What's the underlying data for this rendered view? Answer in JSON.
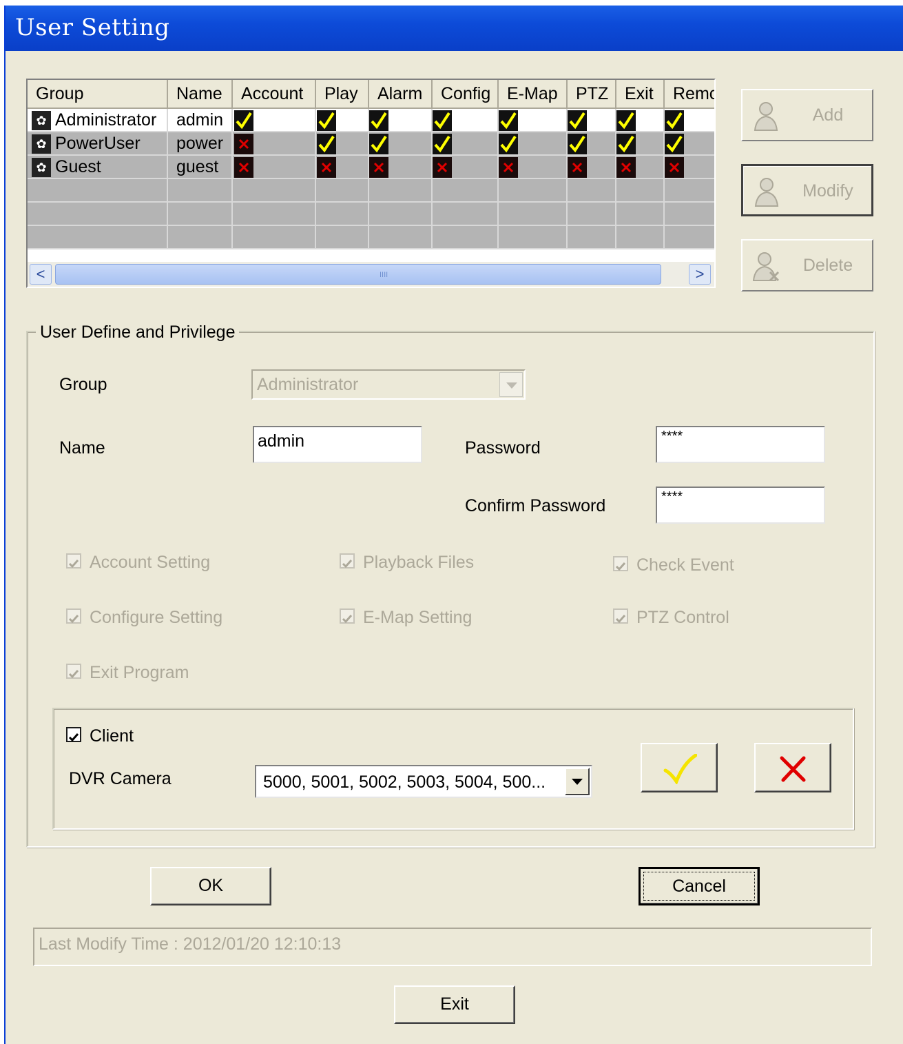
{
  "window": {
    "title": "User Setting"
  },
  "table": {
    "columns": [
      "Group",
      "Name",
      "Account",
      "Play",
      "Alarm",
      "Config",
      "E-Map",
      "PTZ",
      "Exit",
      "Remc"
    ],
    "rows": [
      {
        "group": "Administrator",
        "name": "admin",
        "perms": [
          true,
          true,
          true,
          true,
          true,
          true,
          true,
          true
        ]
      },
      {
        "group": "PowerUser",
        "name": "power",
        "perms": [
          false,
          true,
          true,
          true,
          true,
          true,
          true,
          true
        ]
      },
      {
        "group": "Guest",
        "name": "guest",
        "perms": [
          false,
          false,
          false,
          false,
          false,
          false,
          false,
          false
        ]
      }
    ],
    "scrollbar": {
      "left_arrow": "<",
      "right_arrow": ">",
      "grip": "IIII"
    }
  },
  "side_buttons": {
    "add": "Add",
    "modify": "Modify",
    "delete": "Delete"
  },
  "user_define": {
    "legend": "User Define and Privilege",
    "group_label": "Group",
    "group_value": "Administrator",
    "name_label": "Name",
    "name_value": "admin",
    "password_label": "Password",
    "password_value": "****",
    "confirm_label": "Confirm Password",
    "confirm_value": "****",
    "privileges": [
      {
        "label": "Account Setting",
        "checked": true
      },
      {
        "label": "Playback Files",
        "checked": true
      },
      {
        "label": "Check Event",
        "checked": true
      },
      {
        "label": "Configure Setting",
        "checked": true
      },
      {
        "label": "E-Map Setting",
        "checked": true
      },
      {
        "label": "PTZ Control",
        "checked": true
      },
      {
        "label": "Exit Program",
        "checked": true
      }
    ],
    "client_label": "Client",
    "client_checked": true,
    "dvr_label": "DVR Camera",
    "dvr_value": "5000, 5001, 5002, 5003, 5004, 500..."
  },
  "buttons": {
    "ok": "OK",
    "cancel": "Cancel",
    "exit": "Exit"
  },
  "status": "Last Modify Time : 2012/01/20 12:10:13",
  "colors": {
    "titlebar": "#0d4bd8",
    "check_yes": "#ffff00",
    "check_no": "#e00000",
    "disabled_text": "#aca899"
  }
}
